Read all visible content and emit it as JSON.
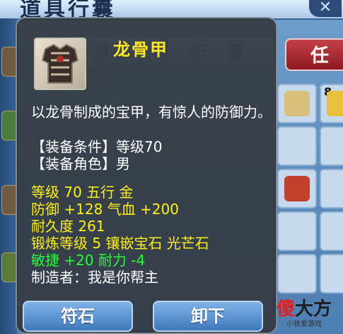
{
  "background": {
    "title": "道具行囊",
    "tabs": [
      "道具",
      "行 囊"
    ],
    "side_button": "任",
    "slot_count": "8"
  },
  "tooltip": {
    "item_name": "龙骨甲",
    "item_icon": "armor-icon",
    "description": "以龙骨制成的宝甲，有惊人的防御力。",
    "equip_condition": "【装备条件】等级70",
    "equip_role": "【装备角色】男",
    "level_line": "等级 70  五行 金",
    "defense_line": "防御 +128  气血 +200",
    "durability_line": "耐久度 261",
    "forge_line": "锻炼等级 5  镶嵌宝石 光芒石",
    "bonus_line": "敏捷 +20  耐力 -4",
    "maker_line": "制造者：我是你帮主",
    "buttons": {
      "fushi": "符石",
      "unequip": "卸下"
    }
  },
  "watermark": {
    "main_red": "傻",
    "main_dark": "大方",
    "sub": "小铁爱游戏"
  },
  "colors": {
    "name": "#ffe823",
    "stat_yellow": "#ffee20",
    "stat_green": "#25ff3a",
    "text_white": "#ffffff",
    "red_button": "#c53f48"
  }
}
